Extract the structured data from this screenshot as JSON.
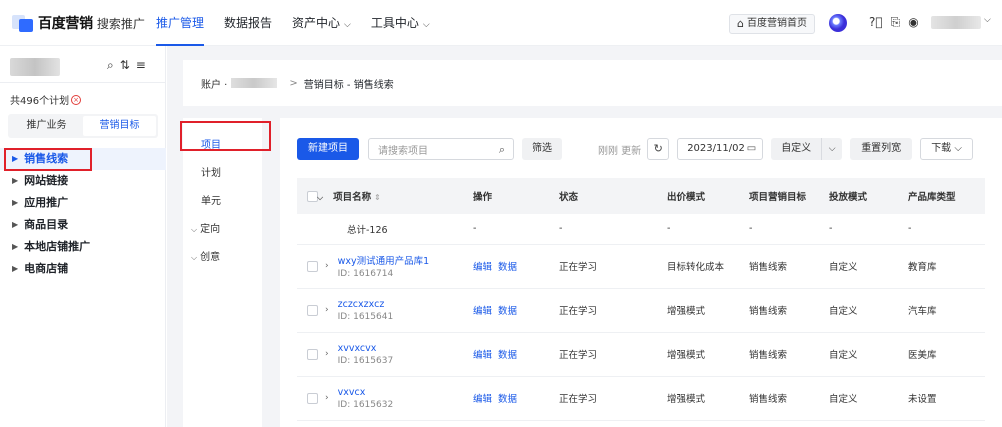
{
  "header": {
    "logo_text": "百度营销",
    "logo_sub": "搜索推广",
    "nav": [
      {
        "label": "推广管理",
        "active": true,
        "dropdown": false
      },
      {
        "label": "数据报告",
        "active": false,
        "dropdown": false
      },
      {
        "label": "资产中心",
        "active": false,
        "dropdown": true
      },
      {
        "label": "工具中心",
        "active": false,
        "dropdown": true
      }
    ],
    "home_button": "百度营销首页"
  },
  "sidebar": {
    "plan_count": "共496个计划",
    "tabs": [
      "推广业务",
      "营销目标"
    ],
    "active_tab": 1,
    "tree": [
      {
        "label": "销售线索",
        "active": true
      },
      {
        "label": "网站链接",
        "active": false
      },
      {
        "label": "应用推广",
        "active": false
      },
      {
        "label": "商品目录",
        "active": false
      },
      {
        "label": "本地店铺推广",
        "active": false
      },
      {
        "label": "电商店铺",
        "active": false
      }
    ]
  },
  "breadcrumb": {
    "account_prefix": "账户 ·",
    "separator": ">",
    "current": "营销目标 - 销售线索"
  },
  "subnav": [
    {
      "label": "项目",
      "active": true,
      "expandable": false
    },
    {
      "label": "计划",
      "active": false,
      "expandable": false
    },
    {
      "label": "单元",
      "active": false,
      "expandable": false
    },
    {
      "label": "定向",
      "active": false,
      "expandable": true
    },
    {
      "label": "创意",
      "active": false,
      "expandable": true
    }
  ],
  "toolbar": {
    "new_button": "新建项目",
    "search_placeholder": "请搜索项目",
    "filter_button": "筛选",
    "refresh_text": "刚刚 更新",
    "date": "2023/11/02",
    "custom_button": "自定义",
    "reset_button": "重置列宽",
    "download_button": "下载"
  },
  "table": {
    "headers": [
      "项目名称",
      "操作",
      "状态",
      "出价模式",
      "项目营销目标",
      "投放模式",
      "产品库类型"
    ],
    "total": {
      "label": "总计-126",
      "cells": [
        "-",
        "-",
        "-",
        "-",
        "-",
        "-"
      ]
    },
    "rows": [
      {
        "name": "wxy测试通用产品库1",
        "id": "ID: 1616714",
        "actions": [
          "编辑",
          "数据"
        ],
        "status": "正在学习",
        "bid_mode": "目标转化成本",
        "goal": "销售线索",
        "delivery": "自定义",
        "library": "教育库"
      },
      {
        "name": "zczcxzxcz",
        "id": "ID: 1615641",
        "actions": [
          "编辑",
          "数据"
        ],
        "status": "正在学习",
        "bid_mode": "增强模式",
        "goal": "销售线索",
        "delivery": "自定义",
        "library": "汽车库"
      },
      {
        "name": "xvvxcvx",
        "id": "ID: 1615637",
        "actions": [
          "编辑",
          "数据"
        ],
        "status": "正在学习",
        "bid_mode": "增强模式",
        "goal": "销售线索",
        "delivery": "自定义",
        "library": "医美库"
      },
      {
        "name": "vxvcx",
        "id": "ID: 1615632",
        "actions": [
          "编辑",
          "数据"
        ],
        "status": "正在学习",
        "bid_mode": "增强模式",
        "goal": "销售线索",
        "delivery": "自定义",
        "library": "未设置"
      }
    ]
  },
  "colors": {
    "accent": "#1a59e8",
    "highlight_box": "#e0202a"
  }
}
